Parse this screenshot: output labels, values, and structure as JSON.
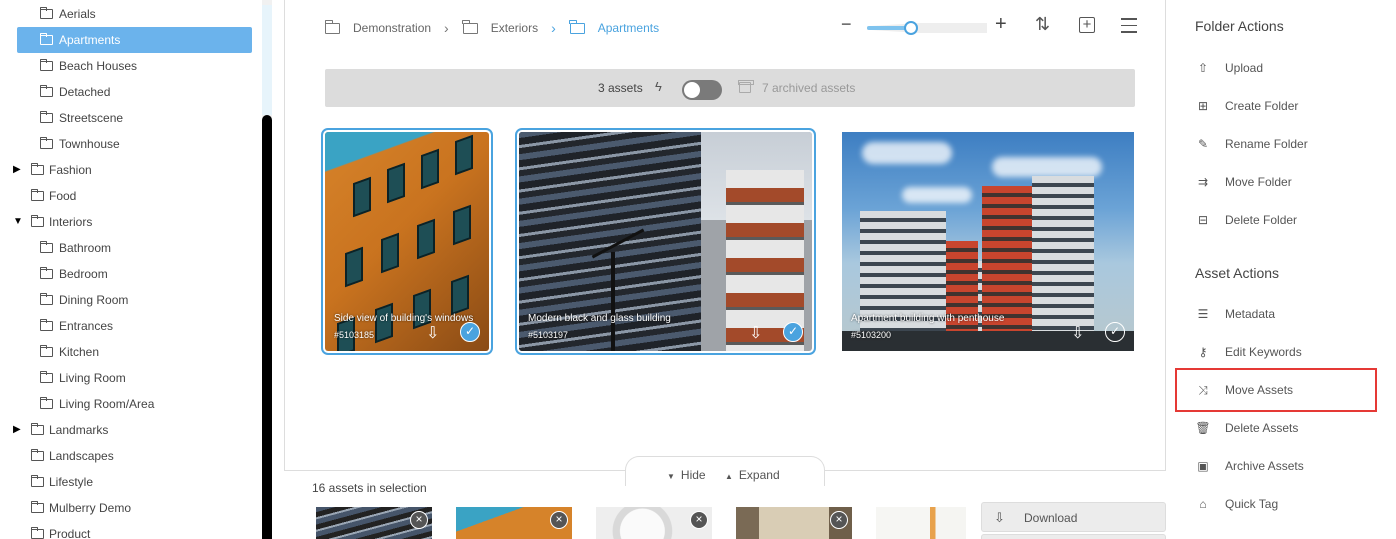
{
  "tree": {
    "items": [
      {
        "label": "Aerials",
        "level": 2,
        "selected": false,
        "caret": ""
      },
      {
        "label": "Apartments",
        "level": 2,
        "selected": true,
        "caret": ""
      },
      {
        "label": "Beach Houses",
        "level": 2,
        "selected": false,
        "caret": ""
      },
      {
        "label": "Detached",
        "level": 2,
        "selected": false,
        "caret": ""
      },
      {
        "label": "Streetscene",
        "level": 2,
        "selected": false,
        "caret": ""
      },
      {
        "label": "Townhouse",
        "level": 2,
        "selected": false,
        "caret": ""
      },
      {
        "label": "Fashion",
        "level": 1,
        "selected": false,
        "caret": "▶"
      },
      {
        "label": "Food",
        "level": 1,
        "selected": false,
        "caret": ""
      },
      {
        "label": "Interiors",
        "level": 1,
        "selected": false,
        "caret": "▼"
      },
      {
        "label": "Bathroom",
        "level": 2,
        "selected": false,
        "caret": ""
      },
      {
        "label": "Bedroom",
        "level": 2,
        "selected": false,
        "caret": ""
      },
      {
        "label": "Dining Room",
        "level": 2,
        "selected": false,
        "caret": ""
      },
      {
        "label": "Entrances",
        "level": 2,
        "selected": false,
        "caret": ""
      },
      {
        "label": "Kitchen",
        "level": 2,
        "selected": false,
        "caret": ""
      },
      {
        "label": "Living Room",
        "level": 2,
        "selected": false,
        "caret": ""
      },
      {
        "label": "Living Room/Area",
        "level": 2,
        "selected": false,
        "caret": ""
      },
      {
        "label": "Landmarks",
        "level": 1,
        "selected": false,
        "caret": "▶"
      },
      {
        "label": "Landscapes",
        "level": 1,
        "selected": false,
        "caret": ""
      },
      {
        "label": "Lifestyle",
        "level": 1,
        "selected": false,
        "caret": ""
      },
      {
        "label": "Mulberry Demo",
        "level": 1,
        "selected": false,
        "caret": ""
      },
      {
        "label": "Product",
        "level": 1,
        "selected": false,
        "caret": ""
      }
    ]
  },
  "breadcrumb": {
    "items": [
      "Demonstration",
      "Exteriors",
      "Apartments"
    ]
  },
  "toolbar": {
    "zoom_minus": "−",
    "zoom_plus": "+",
    "zoom_level": 0.3,
    "sort_icon": "sort-icon",
    "sort_glyph": "⇅",
    "add_glyph": "+"
  },
  "assets_bar": {
    "asset_count": "3 assets",
    "bolt_glyph": "ϟ",
    "archived_count": "7 archived assets",
    "toggle_on": false
  },
  "cards": [
    {
      "title": "Side view of building's windows",
      "code": "#5103185",
      "selected": true
    },
    {
      "title": "Modern black and glass building",
      "code": "#5103197",
      "selected": true
    },
    {
      "title": "Apartment building with penthouse",
      "code": "#5103200",
      "selected": false
    }
  ],
  "card_glyphs": {
    "download": "⇩",
    "check": "✓"
  },
  "tray": {
    "hide_label": "Hide",
    "expand_label": "Expand",
    "hide_glyph": "▼",
    "expand_glyph": "▲",
    "selection_count": "16 assets in selection",
    "remove_glyph": "×",
    "download_label": "Download",
    "download_glyph": "⇩"
  },
  "folder_actions": {
    "title": "Folder Actions",
    "items": [
      {
        "label": "Upload",
        "glyph": "⇧"
      },
      {
        "label": "Create Folder",
        "glyph": "⊞"
      },
      {
        "label": "Rename Folder",
        "glyph": "✎"
      },
      {
        "label": "Move Folder",
        "glyph": "⇉"
      },
      {
        "label": "Delete Folder",
        "glyph": "⊟"
      }
    ]
  },
  "asset_actions": {
    "title": "Asset Actions",
    "items": [
      {
        "label": "Metadata",
        "glyph": "☰"
      },
      {
        "label": "Edit Keywords",
        "glyph": "⚷"
      },
      {
        "label": "Move Assets",
        "glyph": "⤨"
      },
      {
        "label": "Delete Assets",
        "glyph": "🗑"
      },
      {
        "label": "Archive Assets",
        "glyph": "▣"
      },
      {
        "label": "Quick Tag",
        "glyph": "⌂"
      }
    ]
  },
  "colors": {
    "accent": "#4aa3df",
    "selected_row": "#6bb3ec",
    "highlight_box": "#e53935"
  }
}
